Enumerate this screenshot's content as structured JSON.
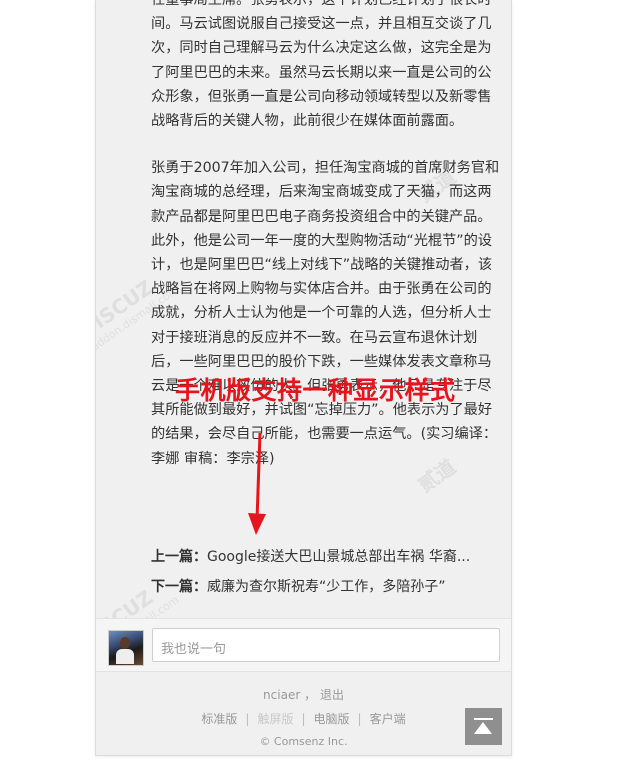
{
  "article": {
    "paragraph1": "任董事局主席。张勇表示，这个计划已经计划了很长时间。马云试图说服自己接受这一点，并且相互交谈了几次，同时自己理解马云为什么决定这么做，这完全是为了阿里巴巴的未来。虽然马云长期以来一直是公司的公众形象，但张勇一直是公司向移动领域转型以及新零售战略背后的关键人物，此前很少在媒体面前露面。",
    "paragraph2": "张勇于2007年加入公司，担任淘宝商城的首席财务官和淘宝商城的总经理，后来淘宝商城变成了天猫，而这两款产品都是阿里巴巴电子商务投资组合中的关键产品。此外，他是公司一年一度的大型购物活动“光棍节”的设计，也是阿里巴巴“线上对线下”战略的关键推动者，该战略旨在将网上购物与实体店合并。由于张勇在公司的成就，分析人士认为他是一个可靠的人选，但分析人士对于接班消息的反应并不一致。在马云宣布退休计划后，一些阿里巴巴的股价下跌，一些媒体发表文章称马云是一个难以效仿的人。但张勇表示，他只是专注于尽其所能做到最好，并试图“忘掉压力”。他表示为了最好的结果，会尽自己所能，也需要一点运气。(实习编译：李娜 审稿：李宗泽)"
  },
  "nav": {
    "prev_label": "上一篇：",
    "prev_title": "Google接送大巴山景城总部出车祸 华裔...",
    "next_label": "下一篇：",
    "next_title": "威廉为查尔斯祝寿“少工作，多陪孙子”"
  },
  "comment": {
    "placeholder": "我也说一句"
  },
  "footer": {
    "username": "nciaer",
    "user_sep": "，",
    "logout": "退出",
    "links": [
      "标准版",
      "触屏版",
      "电脑版",
      "客户端"
    ],
    "link_sep": "|",
    "copyright": "© Comsenz Inc."
  },
  "annotation": {
    "text": "手机版支持一种显示样式",
    "color": "#e8141c"
  },
  "watermark": {
    "brand": "DISCUZ",
    "sub": "addon.dismall.com",
    "cn": "贰道"
  },
  "colors": {
    "phone_bg": "#f0f0f0",
    "text": "#333333",
    "muted": "#999999",
    "scroll_top_bg": "#8f8f8f"
  },
  "icons": {
    "back_to_top": "back-to-top-icon"
  }
}
